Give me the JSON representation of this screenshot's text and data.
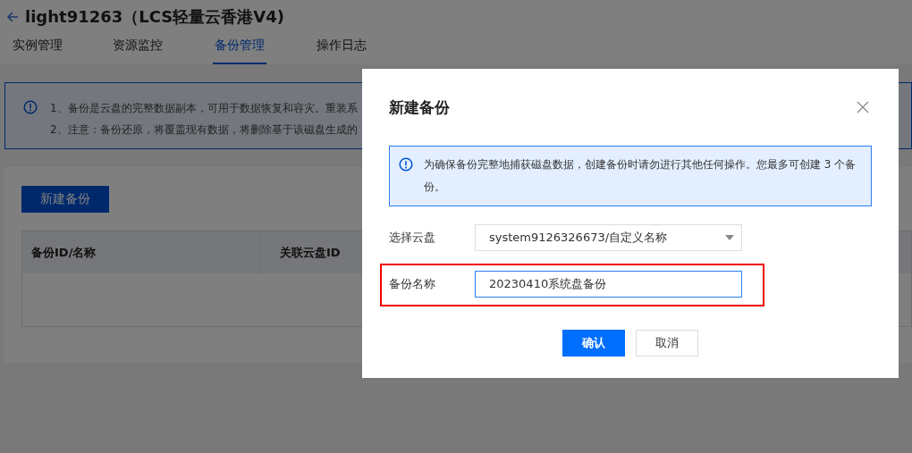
{
  "page": {
    "title": "light91263（LCS轻量云香港V4)",
    "tabs": [
      {
        "label": "实例管理",
        "selected": false
      },
      {
        "label": "资源监控",
        "selected": false
      },
      {
        "label": "备份管理",
        "selected": true
      },
      {
        "label": "操作日志",
        "selected": false
      }
    ],
    "notice": [
      "1、备份是云盘的完整数据副本，可用于数据恢复和容灾。重装系",
      "2、注意：备份还原，将覆盖现有数据，将删除基于该磁盘生成的"
    ],
    "create_button": "新建备份",
    "table": {
      "columns": [
        "备份ID/名称",
        "关联云盘ID"
      ]
    }
  },
  "dialog": {
    "title": "新建备份",
    "notice": "为确保备份完整地捕获磁盘数据，创建备份时请勿进行其他任何操作。您最多可创建 3 个备份。",
    "fields": [
      {
        "kind": "select",
        "label": "选择云盘",
        "value": "system9126326673/自定义名称",
        "highlighted": false
      },
      {
        "kind": "text",
        "label": "备份名称",
        "value": "20230410系统盘备份",
        "highlighted": true
      }
    ],
    "confirm": "确认",
    "cancel": "取消"
  }
}
